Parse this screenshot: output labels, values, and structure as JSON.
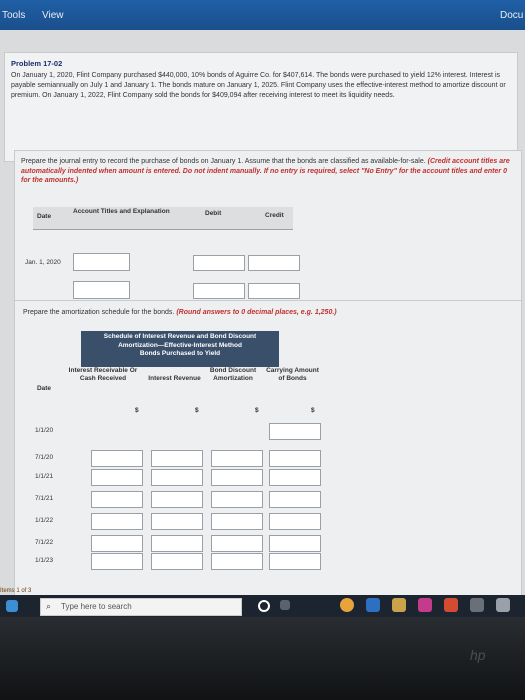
{
  "topbar": {
    "menu_tools": "Tools",
    "menu_view": "View",
    "right_label": "Docu"
  },
  "problem": {
    "title": "Problem 17-02",
    "text": "On January 1, 2020, Flint Company purchased $440,000, 10% bonds of Aguirre Co. for $407,614. The bonds were purchased to yield 12% interest. Interest is payable semiannually on July 1 and January 1. The bonds mature on January 1, 2025. Flint Company uses the effective-interest method to amortize discount or premium. On January 1, 2022, Flint Company sold the bonds for $409,094 after receiving interest to meet its liquidity needs."
  },
  "journal": {
    "prompt": "Prepare the journal entry to record the purchase of bonds on January 1. Assume that the bonds are classified as available-for-sale.",
    "note": "(Credit account titles are automatically indented when amount is entered. Do not indent manually. If no entry is required, select \"No Entry\" for the account titles and enter 0 for the amounts.)",
    "col_date": "Date",
    "col_account": "Account Titles and Explanation",
    "col_debit": "Debit",
    "col_credit": "Credit",
    "row_date": "Jan. 1, 2020"
  },
  "amort": {
    "prompt": "Prepare the amortization schedule for the bonds.",
    "note": "(Round answers to 0 decimal places, e.g. 1,250.)",
    "title_line1": "Schedule of Interest Revenue and Bond Discount",
    "title_line2": "Amortization—Effective-Interest Method",
    "title_line3": "Bonds Purchased to Yield",
    "col_date": "Date",
    "col_interest_receivable": "Interest Receivable Or Cash Received",
    "col_interest_revenue": "Interest Revenue",
    "col_bond_discount": "Bond Discount Amortization",
    "col_carrying": "Carrying Amount of Bonds",
    "currency": "$",
    "rows": [
      "1/1/20",
      "7/1/20",
      "1/1/21",
      "7/1/21",
      "1/1/22",
      "7/1/22",
      "1/1/23"
    ]
  },
  "footer": {
    "items_label": "Items 1 of 3"
  },
  "taskbar": {
    "search_placeholder": "Type here to search"
  }
}
